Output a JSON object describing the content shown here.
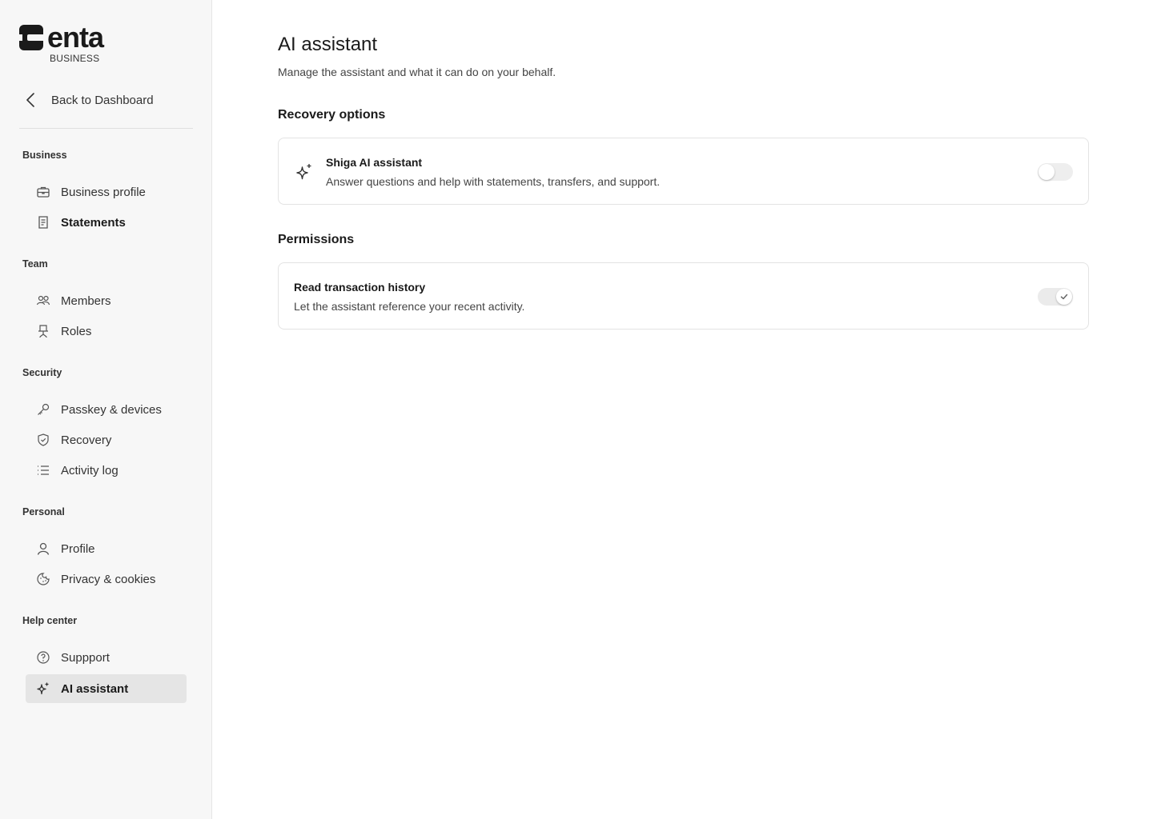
{
  "brand": {
    "name": "enta",
    "subtitle": "BUSINESS"
  },
  "back": {
    "label": "Back to Dashboard"
  },
  "sidebar": {
    "sections": [
      {
        "title": "Business",
        "items": [
          {
            "label": "Business profile",
            "icon": "briefcase-icon"
          },
          {
            "label": "Statements",
            "icon": "document-icon"
          }
        ]
      },
      {
        "title": "Team",
        "items": [
          {
            "label": "Members",
            "icon": "users-icon"
          },
          {
            "label": "Roles",
            "icon": "chair-icon"
          }
        ]
      },
      {
        "title": "Security",
        "items": [
          {
            "label": "Passkey & devices",
            "icon": "key-icon"
          },
          {
            "label": "Recovery",
            "icon": "shield-check-icon"
          },
          {
            "label": "Activity log",
            "icon": "list-icon"
          }
        ]
      },
      {
        "title": "Personal",
        "items": [
          {
            "label": "Profile",
            "icon": "user-icon"
          },
          {
            "label": "Privacy & cookies",
            "icon": "cookie-icon"
          }
        ]
      },
      {
        "title": "Help center",
        "items": [
          {
            "label": "Suppport",
            "icon": "help-circle-icon"
          },
          {
            "label": "AI assistant",
            "icon": "sparkles-icon"
          }
        ]
      }
    ],
    "active_item": "AI assistant"
  },
  "main": {
    "title": "AI assistant",
    "subtitle": "Manage the assistant and what it can do on your behalf.",
    "recovery_section_title": "Recovery options",
    "assistant_card": {
      "icon": "sparkles-icon",
      "title": "Shiga AI assistant",
      "description": "Answer questions and help with statements, transfers, and support.",
      "enabled": false
    },
    "permissions_section_title": "Permissions",
    "permission_card": {
      "title": "Read transaction history",
      "description": "Let the assistant reference your recent activity.",
      "enabled": true
    }
  },
  "colors": {
    "sidebar_bg": "#f7f7f7",
    "active_item_bg": "#e5e5e5",
    "text": "#1a1a1a",
    "border": "#e3e3e3"
  }
}
